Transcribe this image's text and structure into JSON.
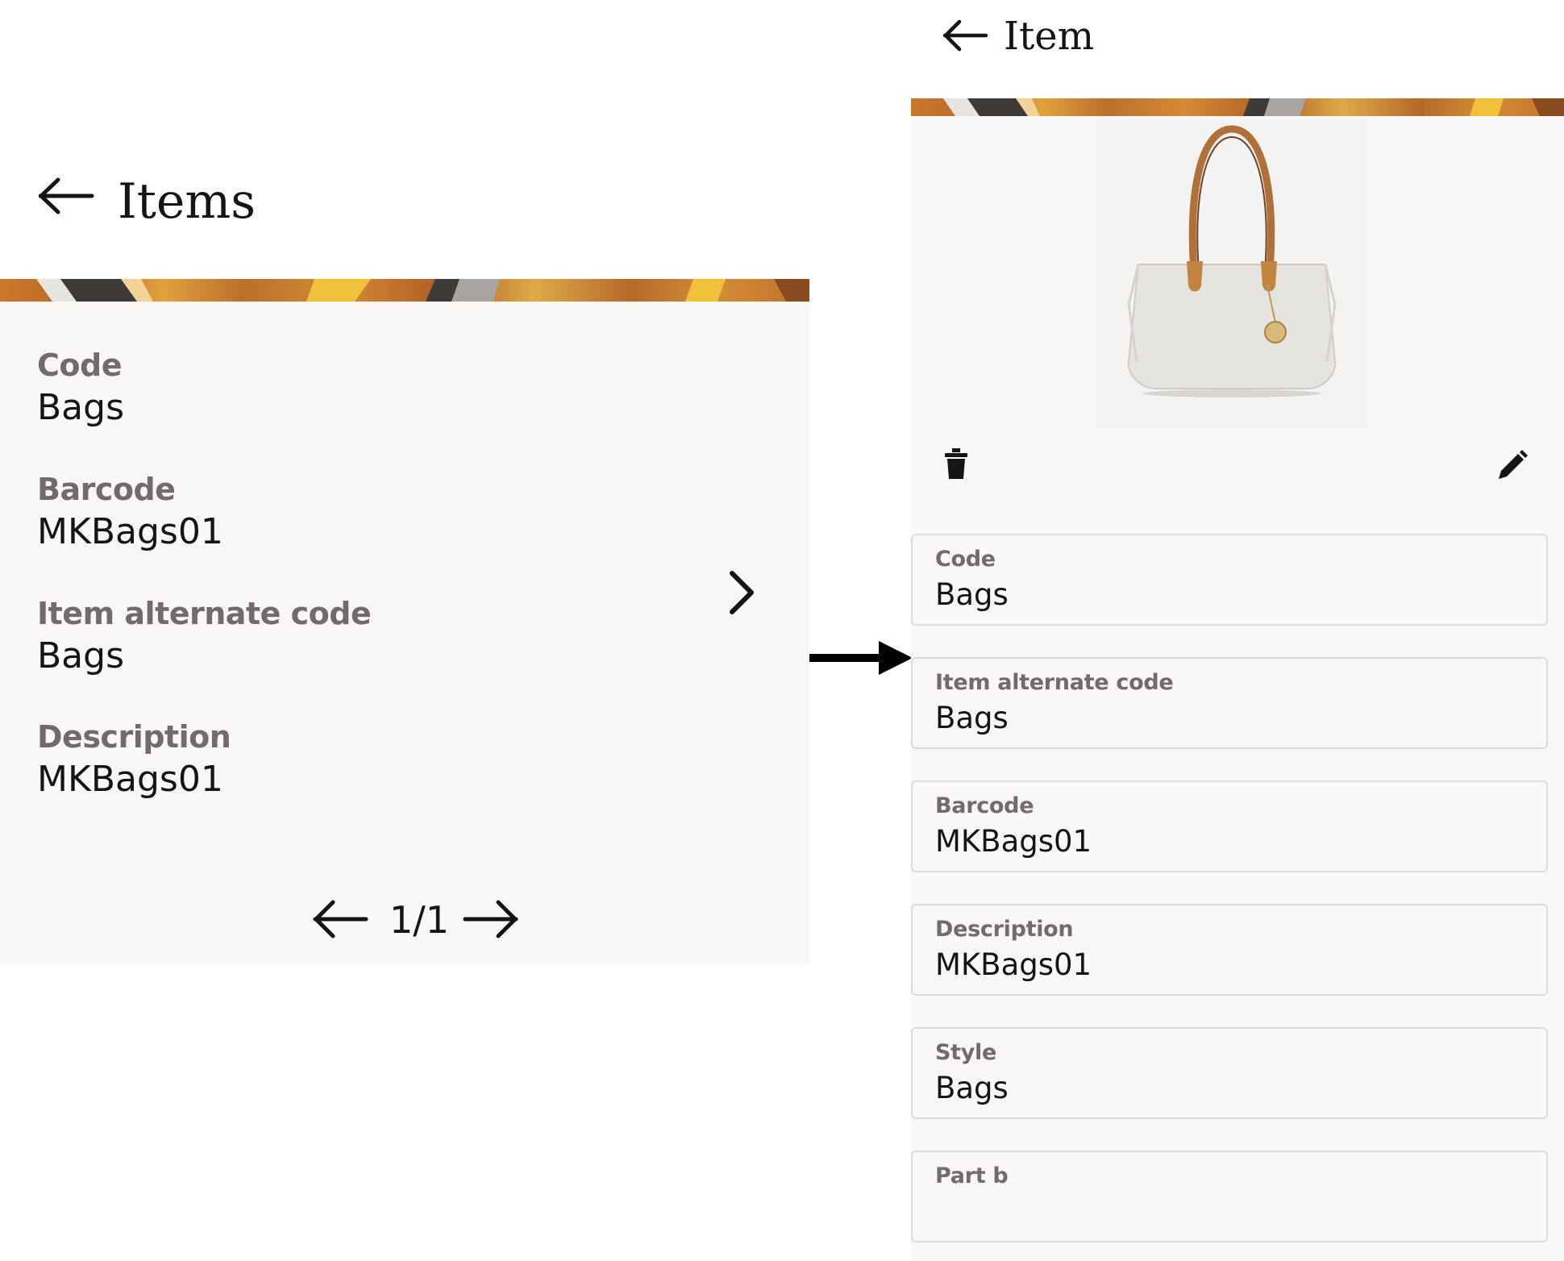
{
  "left_screen": {
    "title": "Items",
    "fields": [
      {
        "label": "Code",
        "value": "Bags"
      },
      {
        "label": "Barcode",
        "value": "MKBags01"
      },
      {
        "label": "Item alternate code",
        "value": "Bags"
      },
      {
        "label": "Description",
        "value": "MKBags01"
      }
    ],
    "pager": "1/1"
  },
  "right_screen": {
    "title": "Item",
    "fields": [
      {
        "label": "Code",
        "value": "Bags"
      },
      {
        "label": "Item alternate code",
        "value": "Bags"
      },
      {
        "label": "Barcode",
        "value": "MKBags01"
      },
      {
        "label": "Description",
        "value": "MKBags01"
      },
      {
        "label": "Style",
        "value": "Bags"
      },
      {
        "label": "Part b",
        "value": ""
      }
    ]
  },
  "icons": [
    "back-arrow-icon",
    "chevron-right-icon",
    "arrow-left-icon",
    "arrow-right-icon",
    "trash-icon",
    "pencil-icon",
    "transition-arrow-icon",
    "handbag-image"
  ],
  "colors": {
    "panel": "#f9f8f6",
    "label": "#6f6c69",
    "text": "#161513",
    "banner": "#c8782c"
  }
}
